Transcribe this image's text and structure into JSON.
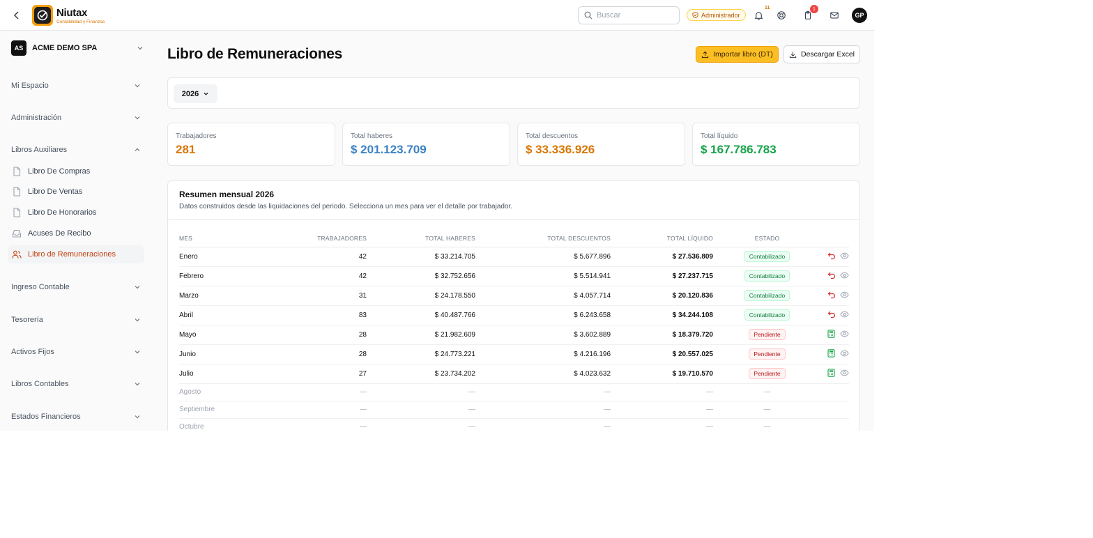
{
  "brand": {
    "name": "Niutax",
    "tagline": "Contabilidad y Finanzas"
  },
  "topbar": {
    "search_placeholder": "Buscar",
    "role": "Administrador",
    "notifications_count": "11",
    "tasks_count": "1",
    "user_initials": "GP"
  },
  "sidebar": {
    "company": {
      "initials": "AS",
      "name": "ACME DEMO SPA"
    },
    "sections": [
      {
        "label": "Mi Espacio"
      },
      {
        "label": "Administración"
      },
      {
        "label": "Libros Auxiliares"
      },
      {
        "label": "Ingreso Contable"
      },
      {
        "label": "Tesorería"
      },
      {
        "label": "Activos Fijos"
      },
      {
        "label": "Libros Contables"
      },
      {
        "label": "Estados Financieros"
      }
    ],
    "aux_items": [
      {
        "label": "Libro De Compras",
        "icon": "file-icon"
      },
      {
        "label": "Libro De Ventas",
        "icon": "file-icon"
      },
      {
        "label": "Libro De Honorarios",
        "icon": "file-icon"
      },
      {
        "label": "Acuses De Recibo",
        "icon": "inbox-icon"
      },
      {
        "label": "Libro de Remuneraciones",
        "icon": "users-icon"
      }
    ]
  },
  "page": {
    "title": "Libro de Remuneraciones",
    "import_label": "Importar libro (DT)",
    "export_label": "Descargar Excel",
    "year": "2026"
  },
  "kpis": [
    {
      "label": "Trabajadores",
      "value": "281",
      "color": "#d97706"
    },
    {
      "label": "Total haberes",
      "value": "$ 201.123.709",
      "color": "#3b82c4"
    },
    {
      "label": "Total descuentos",
      "value": "$ 33.336.926",
      "color": "#d97706"
    },
    {
      "label": "Total líquido",
      "value": "$ 167.786.783",
      "color": "#16a34a"
    }
  ],
  "summary": {
    "title": "Resumen mensual 2026",
    "subtitle": "Datos construidos desde las liquidaciones del periodo. Selecciona un mes para ver el detalle por trabajador.",
    "columns": [
      "MES",
      "TRABAJADORES",
      "TOTAL HABERES",
      "TOTAL DESCUENTOS",
      "TOTAL LÍQUIDO",
      "ESTADO"
    ],
    "rows": [
      {
        "mes": "Enero",
        "trabajadores": "42",
        "haberes": "$ 33.214.705",
        "descuentos": "$ 5.677.896",
        "liquido": "$ 27.536.809",
        "estado": "Contabilizado"
      },
      {
        "mes": "Febrero",
        "trabajadores": "42",
        "haberes": "$ 32.752.656",
        "descuentos": "$ 5.514.941",
        "liquido": "$ 27.237.715",
        "estado": "Contabilizado"
      },
      {
        "mes": "Marzo",
        "trabajadores": "31",
        "haberes": "$ 24.178.550",
        "descuentos": "$ 4.057.714",
        "liquido": "$ 20.120.836",
        "estado": "Contabilizado"
      },
      {
        "mes": "Abril",
        "trabajadores": "83",
        "haberes": "$ 40.487.766",
        "descuentos": "$ 6.243.658",
        "liquido": "$ 34.244.108",
        "estado": "Contabilizado"
      },
      {
        "mes": "Mayo",
        "trabajadores": "28",
        "haberes": "$ 21.982.609",
        "descuentos": "$ 3.602.889",
        "liquido": "$ 18.379.720",
        "estado": "Pendiente"
      },
      {
        "mes": "Junio",
        "trabajadores": "28",
        "haberes": "$ 24.773.221",
        "descuentos": "$ 4.216.196",
        "liquido": "$ 20.557.025",
        "estado": "Pendiente"
      },
      {
        "mes": "Julio",
        "trabajadores": "27",
        "haberes": "$ 23.734.202",
        "descuentos": "$ 4.023.632",
        "liquido": "$ 19.710.570",
        "estado": "Pendiente"
      }
    ],
    "empty_rows": [
      {
        "mes": "Agosto",
        "dash": "—"
      },
      {
        "mes": "Septiembre",
        "dash": "—"
      },
      {
        "mes": "Octubre",
        "dash": "—"
      }
    ]
  }
}
